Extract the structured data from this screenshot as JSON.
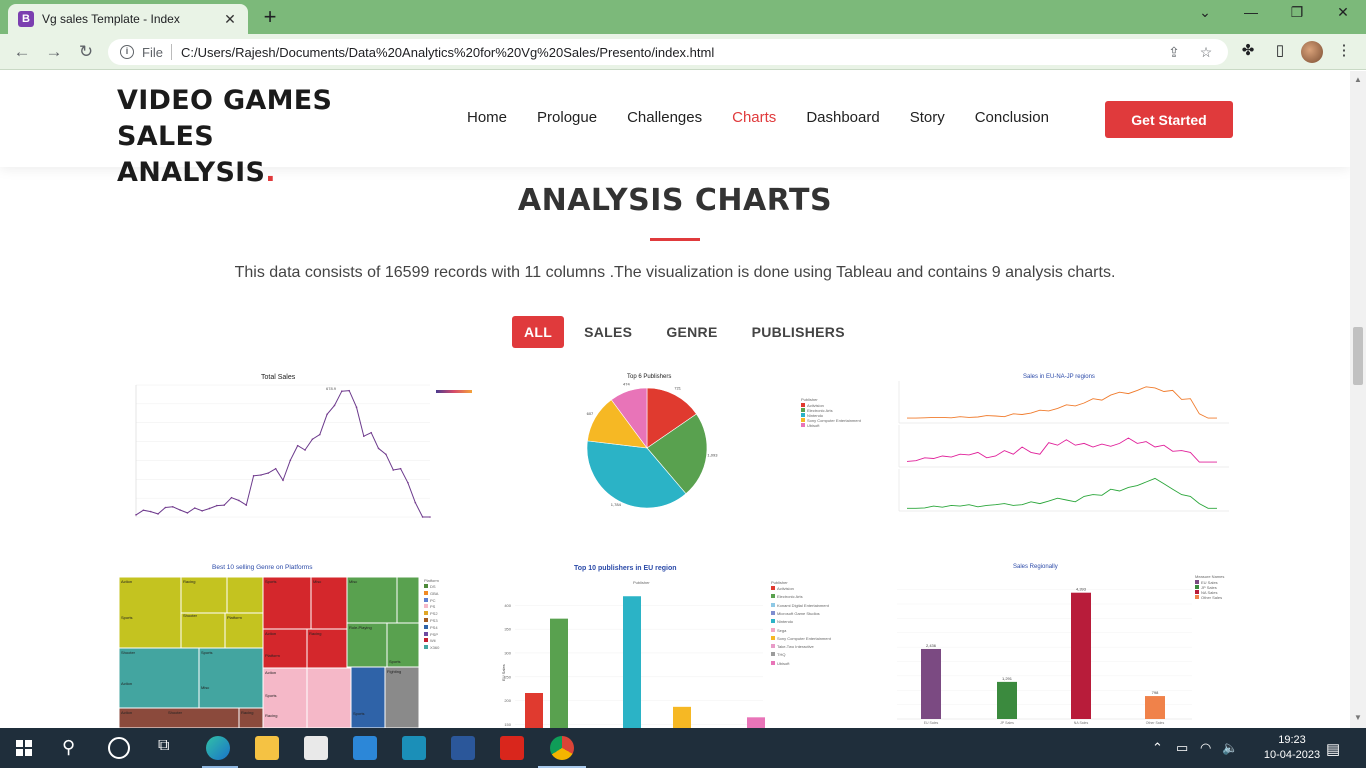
{
  "browser": {
    "tab_title": "Vg sales Template - Index",
    "tab_favicon_letter": "B",
    "address_prefix": "File",
    "address_url": "C:/Users/Rajesh/Documents/Data%20Analytics%20for%20Vg%20Sales/Presento/index.html"
  },
  "site": {
    "logo_line1": "VIDEO GAMES SALES",
    "logo_line2": "ANALYSIS",
    "logo_dot": ".",
    "nav": [
      "Home",
      "Prologue",
      "Challenges",
      "Charts",
      "Dashboard",
      "Story",
      "Conclusion"
    ],
    "nav_active": "Charts",
    "cta_label": "Get Started"
  },
  "section": {
    "title": "ANALYSIS CHARTS",
    "description": "This data consists of 16599 records with 11 columns .The visualization is done using Tableau and contains 9 analysis charts.",
    "filters": [
      "ALL",
      "SALES",
      "GENRE",
      "PUBLISHERS"
    ],
    "active_filter": "ALL"
  },
  "charts": {
    "total_sales": {
      "title": "Total Sales",
      "values": [
        11.4,
        35.8,
        28.9,
        16.5,
        50.4,
        53.9,
        37.1,
        21.7,
        47.5,
        32.5,
        45.2,
        60.7,
        63.2,
        102.5,
        87.6,
        63.3,
        218.4,
        222.7,
        233.1,
        256.1,
        194.5,
        300.5,
        378.5,
        355.2,
        412.4,
        436.8,
        544.4,
        591.4,
        667.3,
        670.1,
        582.4,
        428.3,
        447.2,
        363.6,
        332.5,
        249.1,
        256.2,
        181.6,
        76.2,
        0.2,
        0.0
      ],
      "peak_label": "678.9"
    },
    "top_publishers": {
      "title": "Top 6 Publishers",
      "legend_title": "Publisher",
      "slices": [
        {
          "name": "Activision",
          "value": 721,
          "color": "#e03a2f"
        },
        {
          "name": "Electronic Arts",
          "value": 1093,
          "color": "#59a14f"
        },
        {
          "name": "Nintendo",
          "value": 1784,
          "color": "#2bb3c6"
        },
        {
          "name": "Sony Computer Entertainment",
          "value": 607,
          "color": "#f6b824"
        },
        {
          "name": "Ubisoft",
          "value": 474,
          "color": "#e874b8"
        }
      ],
      "slice_labels": [
        "721",
        "1,093",
        "1,784",
        "607",
        "474"
      ]
    },
    "regional": {
      "title": "Sales in EU-NA-JP regions",
      "series_colors": [
        "#f07b2c",
        "#e0209a",
        "#2aa63a"
      ]
    },
    "treemap": {
      "title": "Best 10 selling Genre on Platforms",
      "legend_title": "Platform",
      "legend": [
        "DS",
        "GBA",
        "PC",
        "PS",
        "PS2",
        "PS3",
        "PS4",
        "PSP",
        "Wii",
        "X360"
      ],
      "legend_colors": [
        "#4e8a3a",
        "#f08a24",
        "#5d7fd1",
        "#f5b8c8",
        "#e0a626",
        "#a15b22",
        "#2f63a8",
        "#6e4aa0",
        "#c42030",
        "#43a5a0"
      ],
      "labels": [
        "Action",
        "Racing",
        "Sports",
        "Shooter",
        "Platform",
        "Misc",
        "Role-Playing",
        "Simulation",
        "Adventure",
        "Fighting"
      ]
    },
    "eu_publishers": {
      "title": "Top 10 publishers in EU region",
      "x_header": "Publisher",
      "ylabel": "EU Sales",
      "legend_title": "Publisher",
      "legend": [
        "Activision",
        "Electronic Arts",
        "Konami Digital Entertainment",
        "Microsoft Game Studios",
        "Nintendo",
        "Sega",
        "Sony Computer Entertainment",
        "Take-Two Interactive",
        "THQ",
        "Ubisoft"
      ],
      "legend_colors": [
        "#e03a2f",
        "#59a14f",
        "#8ec9e6",
        "#7f8ed0",
        "#2bb3c6",
        "#f3a6c3",
        "#f6b824",
        "#e89cc8",
        "#9c9c9c",
        "#e874b8"
      ],
      "yticks": [
        "400",
        "350",
        "300",
        "250",
        "200",
        "150"
      ],
      "bars": [
        {
          "name": "Activision",
          "value": 216,
          "color": "#e03a2f"
        },
        {
          "name": "Electronic Arts",
          "value": 372,
          "color": "#59a14f"
        },
        {
          "name": "Nintendo",
          "value": 419,
          "color": "#2bb3c6"
        },
        {
          "name": "Sony Computer Entertainment",
          "value": 187,
          "color": "#f6b824"
        },
        {
          "name": "Ubisoft",
          "value": 165,
          "color": "#e874b8"
        }
      ]
    },
    "sales_regionally": {
      "title": "Sales Regionally",
      "legend_title": "Measure Names",
      "categories": [
        "EU Sales",
        "JP Sales",
        "NA Sales",
        "Other Sales"
      ],
      "values": [
        2436,
        1291,
        4393,
        798
      ],
      "labels": [
        "2,436",
        "1,291",
        "4,393",
        "798"
      ],
      "colors": [
        "#7b4a82",
        "#3b8a3e",
        "#b81c3a",
        "#f0824a"
      ]
    }
  },
  "taskbar": {
    "time": "19:23",
    "date": "10-04-2023"
  }
}
